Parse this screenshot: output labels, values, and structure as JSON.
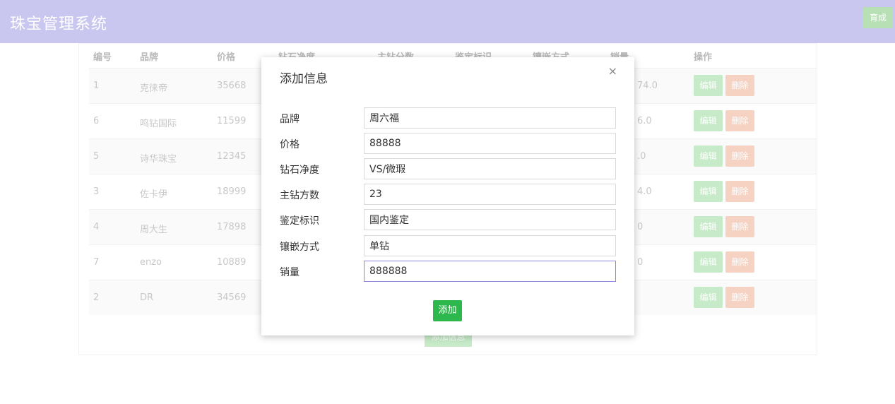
{
  "header": {
    "title": "珠宝管理系统",
    "user_button": "育成"
  },
  "table": {
    "columns": [
      "编号",
      "品牌",
      "价格",
      "钻石净度",
      "主钻分数",
      "鉴定标识",
      "镶嵌方式",
      "销量",
      "操作"
    ],
    "rows": [
      {
        "id": "1",
        "brand": "克徕帝",
        "price": "35668",
        "sales": "74.0"
      },
      {
        "id": "6",
        "brand": "鸣钻国际",
        "price": "11599",
        "sales": "6.0"
      },
      {
        "id": "5",
        "brand": "诗华珠宝",
        "price": "12345",
        "sales": ".0"
      },
      {
        "id": "3",
        "brand": "佐卡伊",
        "price": "18999",
        "sales": "4.0"
      },
      {
        "id": "4",
        "brand": "周大生",
        "price": "17898",
        "sales": "0"
      },
      {
        "id": "7",
        "brand": "enzo",
        "price": "10889",
        "sales": "0"
      },
      {
        "id": "2",
        "brand": "DR",
        "price": "34569",
        "sales": ""
      }
    ],
    "edit_label": "编辑",
    "delete_label": "删除",
    "add_label": "添加信息"
  },
  "modal": {
    "title": "添加信息",
    "close": "×",
    "fields": [
      {
        "label": "品牌",
        "value": "周六福"
      },
      {
        "label": "价格",
        "value": "88888"
      },
      {
        "label": "钻石净度",
        "value": "VS/微瑕"
      },
      {
        "label": "主钻方数",
        "value": "23"
      },
      {
        "label": "鉴定标识",
        "value": "国内鉴定"
      },
      {
        "label": "镶嵌方式",
        "value": "单钻"
      },
      {
        "label": "销量",
        "value": "888888"
      }
    ],
    "submit": "添加"
  }
}
